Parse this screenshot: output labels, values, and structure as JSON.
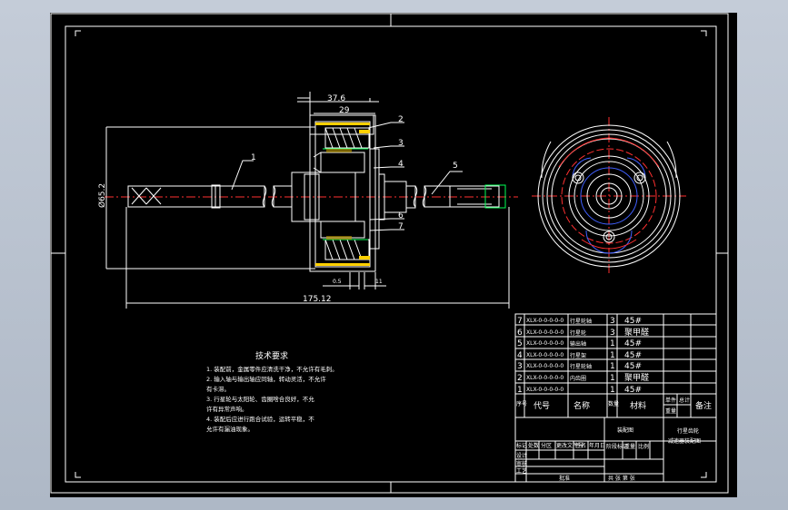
{
  "drawing": {
    "dims": {
      "d1": "37.6",
      "d2": "29",
      "diameter": "Ø65.2",
      "small": "0.5",
      "small2": "11",
      "overall": "175.12"
    },
    "balloons": [
      "1",
      "2",
      "3",
      "4",
      "5",
      "6",
      "7"
    ]
  },
  "tech_notes": {
    "title": "技术要求",
    "lines": [
      "1. 装配前，金属零件应清洗干净，不允许有毛刺。",
      "2. 输入轴与输出轴应同轴，转动灵活，不允许",
      "   有卡滞。",
      "3. 行星轮与太阳轮、齿圈啥合良好，不允",
      "   许有异常声响。",
      "4. 装配后应进行跑合试验，运转平稳，不",
      "   允许有漏油现象。"
    ]
  },
  "bom": {
    "rows": [
      {
        "no": "7",
        "code": "XLX-0-0-0-0-0",
        "name": "行星轮轴",
        "qty": "3",
        "mat": "45#"
      },
      {
        "no": "6",
        "code": "XLX-0-0-0-0-0",
        "name": "行星轮",
        "qty": "3",
        "mat": "聚甲醛"
      },
      {
        "no": "5",
        "code": "XLX-0-0-0-0-0",
        "name": "输出轴",
        "qty": "1",
        "mat": "45#"
      },
      {
        "no": "4",
        "code": "XLX-0-0-0-0-0",
        "name": "行星架",
        "qty": "1",
        "mat": "45#"
      },
      {
        "no": "3",
        "code": "XLX-0-0-0-0-0",
        "name": "行星轮轴",
        "qty": "1",
        "mat": "45#"
      },
      {
        "no": "2",
        "code": "XLX-0-0-0-0-0",
        "name": "内齿圈",
        "qty": "1",
        "mat": "聚甲醛"
      },
      {
        "no": "1",
        "code": "XLX-0-0-0-0-0",
        "name": "",
        "qty": "1",
        "mat": "45#"
      }
    ],
    "header": {
      "no": "序号",
      "code": "代号",
      "name": "名称",
      "qty": "数量",
      "mat": "材料",
      "single": "单件",
      "total": "总计",
      "weight": "重量",
      "remark": "备注"
    }
  },
  "title_block": {
    "drawing_name": "装配图",
    "work_title": "行星齿轮",
    "work_title2": "减速器装配图",
    "labels": {
      "mark": "标记",
      "count": "处数",
      "zone": "分区",
      "change_no": "更改文件号",
      "sign": "签名",
      "date": "年月日",
      "design": "设计",
      "check": "审核",
      "process": "工艺",
      "approve": "批准",
      "stage": "阶段标记",
      "weight": "重量",
      "scale": "比例",
      "sheets": "共 张 第 张"
    }
  }
}
